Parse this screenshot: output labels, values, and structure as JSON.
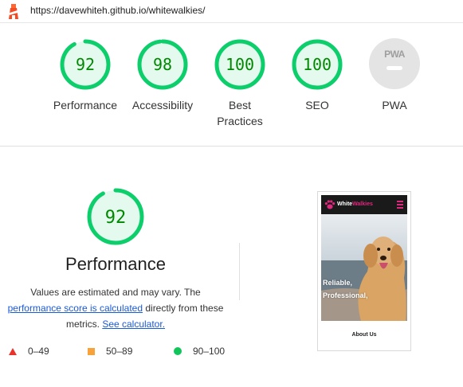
{
  "url_bar": {
    "url": "https://davewhiteh.github.io/whitewalkies/",
    "logo_icon": "lighthouse-icon"
  },
  "colors": {
    "pass": "#0cce6b",
    "pass_fill": "#e5faef",
    "pass_text": "#008800",
    "fail": "#e8332d",
    "average": "#f7a23b",
    "pwa_gray": "#e4e4e4"
  },
  "scores": [
    {
      "value": "92",
      "label": "Performance",
      "fraction": 0.92
    },
    {
      "value": "98",
      "label": "Accessibility",
      "fraction": 0.98
    },
    {
      "value": "100",
      "label": "Best Practices",
      "fraction": 1.0
    },
    {
      "value": "100",
      "label": "SEO",
      "fraction": 1.0
    }
  ],
  "pwa": {
    "badge_text": "PWA",
    "label": "PWA"
  },
  "performance": {
    "score": "92",
    "fraction": 0.92,
    "title": "Performance",
    "desc_1": "Values are estimated and may vary. The",
    "link_calc": "performance score is calculated",
    "desc_2": " directly from these",
    "desc_3": "metrics. ",
    "link_calculator": "See calculator."
  },
  "legend": [
    {
      "range": "0–49",
      "icon": "red-triangle-icon"
    },
    {
      "range": "50–89",
      "icon": "orange-square-icon"
    },
    {
      "range": "90–100",
      "icon": "green-circle-icon"
    }
  ],
  "thumbnail": {
    "brand_white": "White",
    "brand_pink": "Walkies",
    "hero_line_1": "Reliable,",
    "hero_line_2": "Professional,",
    "about": "About Us"
  }
}
